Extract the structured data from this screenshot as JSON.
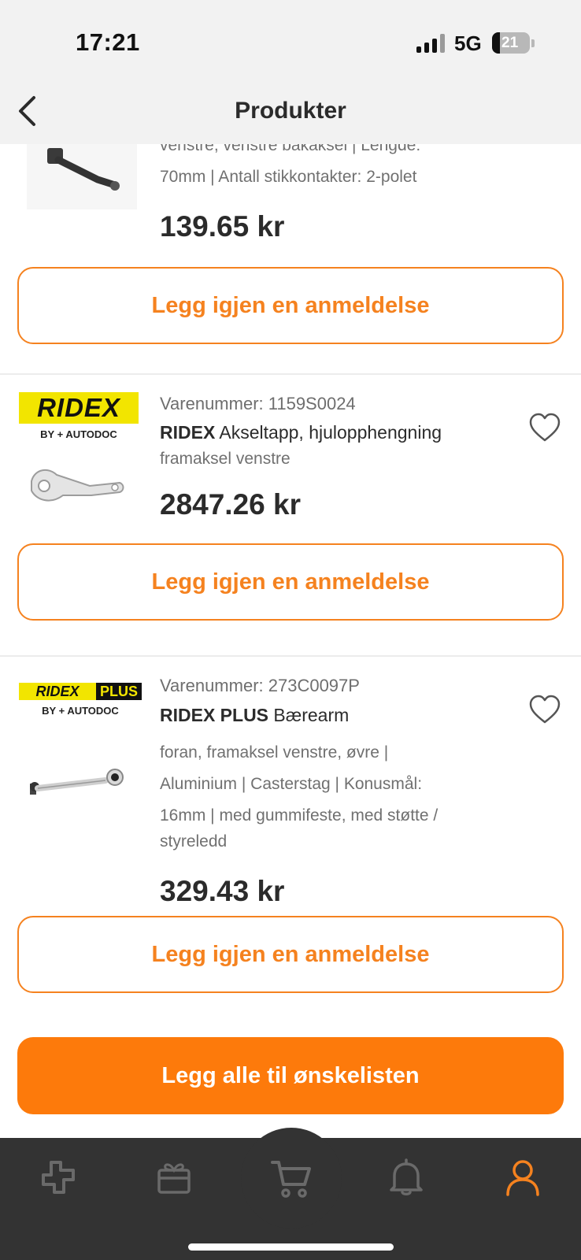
{
  "status": {
    "time": "17:21",
    "network": "5G",
    "battery": "21"
  },
  "nav": {
    "title": "Produkter"
  },
  "colors": {
    "accent": "#fd7a0b",
    "accent_outline": "#f5821f",
    "tabbar": "#333333",
    "active_tab": "#f5821f",
    "inactive_tab": "#6a6a6a"
  },
  "products": [
    {
      "desc_lines": [
        "venstre, venstre bakaksel | Lengde:",
        "70mm | Antall stikkontakter: 2-polet"
      ],
      "price": "139.65 kr",
      "review_label": "Legg igjen en anmeldelse"
    },
    {
      "logo_text": "RIDEX",
      "logo_sub": "BY + AUTODOC",
      "sku": "Varenummer: 1159S0024",
      "brand": "RIDEX",
      "name": "Akseltapp, hjulopphengning",
      "desc": "framaksel venstre",
      "price": "2847.26 kr",
      "review_label": "Legg igjen en anmeldelse"
    },
    {
      "logo_text": "RIDEX",
      "logo_plus": "PLUS",
      "logo_sub": "BY + AUTODOC",
      "sku": "Varenummer: 273C0097P",
      "brand": "RIDEX PLUS",
      "name": "Bærearm",
      "desc_lines": [
        "foran, framaksel venstre, øvre |",
        "Aluminium | Casterstag | Konusmål:",
        "16mm | med gummifeste, med støtte /",
        "styreledd"
      ],
      "price": "329.43 kr",
      "review_label": "Legg igjen en anmeldelse"
    }
  ],
  "wishlist_all_label": "Legg alle til ønskelisten",
  "tabs": [
    {
      "icon": "catalog-icon"
    },
    {
      "icon": "gift-icon"
    },
    {
      "icon": "cart-icon"
    },
    {
      "icon": "bell-icon"
    },
    {
      "icon": "profile-icon",
      "active": true
    }
  ]
}
